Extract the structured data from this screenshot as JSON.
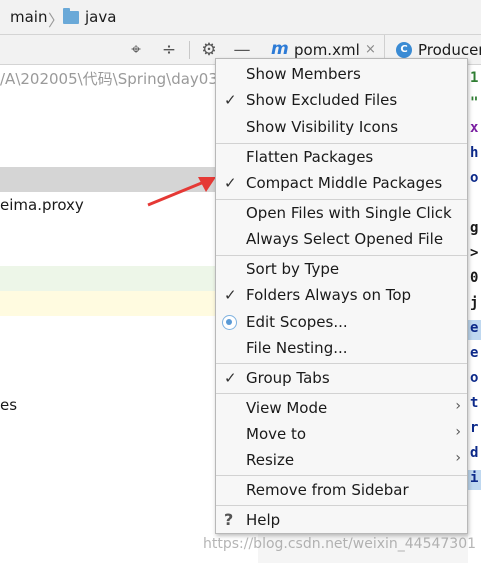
{
  "breadcrumb": {
    "module": "main",
    "folder": "java",
    "sep": "〉"
  },
  "tabs": [
    {
      "icon": "m",
      "label": "pom.xml",
      "close": "×"
    },
    {
      "icon": "C",
      "label": "Producer"
    }
  ],
  "toolbar": {
    "locate": "⌖",
    "collapse": "÷",
    "settings": "⚙",
    "hide": "—"
  },
  "project": {
    "path": "/A\\202005\\代码\\Spring\\day03",
    "package": "eima.proxy",
    "partial_row": "es"
  },
  "menu": {
    "items": [
      {
        "label": "Show Members",
        "checked": false
      },
      {
        "label": "Show Excluded Files",
        "checked": true
      },
      {
        "label": "Show Visibility Icons",
        "checked": false
      },
      {
        "label": "Flatten Packages",
        "checked": false
      },
      {
        "label": "Compact Middle Packages",
        "checked": true
      },
      {
        "label": "Open Files with Single Click",
        "checked": false
      },
      {
        "label": "Always Select Opened File",
        "checked": false
      },
      {
        "label": "Sort by Type",
        "checked": false
      },
      {
        "label": "Folders Always on Top",
        "checked": true
      },
      {
        "label": "Edit Scopes...",
        "radio": true
      },
      {
        "label": "File Nesting...",
        "checked": false
      },
      {
        "label": "Group Tabs",
        "checked": true
      },
      {
        "label": "View Mode",
        "submenu": true
      },
      {
        "label": "Move to",
        "submenu": true
      },
      {
        "label": "Resize",
        "submenu": true
      },
      {
        "label": "Remove from Sidebar"
      },
      {
        "label": "Help",
        "icon": "?"
      }
    ],
    "check_glyph": "✓",
    "chevron_glyph": "›"
  },
  "code_chars": [
    {
      "ch": "1",
      "color": "#2e7d32"
    },
    {
      "ch": "\"",
      "color": "#2e7d32"
    },
    {
      "ch": "x",
      "color": "#7b1fa2"
    },
    {
      "ch": "h",
      "color": "#0d2a8a"
    },
    {
      "ch": "o",
      "color": "#0d2a8a"
    },
    {
      "ch": "g",
      "color": "#1a1a1a"
    },
    {
      "ch": ">",
      "color": "#1a1a1a"
    },
    {
      "ch": "0",
      "color": "#1a1a1a"
    },
    {
      "ch": "j",
      "color": "#1a1a1a"
    },
    {
      "ch": "e",
      "color": "#0d2a8a"
    },
    {
      "ch": "e",
      "color": "#0d2a8a"
    },
    {
      "ch": "o",
      "color": "#0d2a8a"
    },
    {
      "ch": "t",
      "color": "#0d2a8a"
    },
    {
      "ch": "r",
      "color": "#0d2a8a"
    },
    {
      "ch": "d",
      "color": "#0d2a8a"
    },
    {
      "ch": "i",
      "color": "#0d2a8a"
    }
  ],
  "watermark": "https://blog.csdn.net/weixin_44547301",
  "colors": {
    "accent": "#2d7bd6",
    "arrow": "#e53935",
    "selection": "#bfd8f0"
  }
}
